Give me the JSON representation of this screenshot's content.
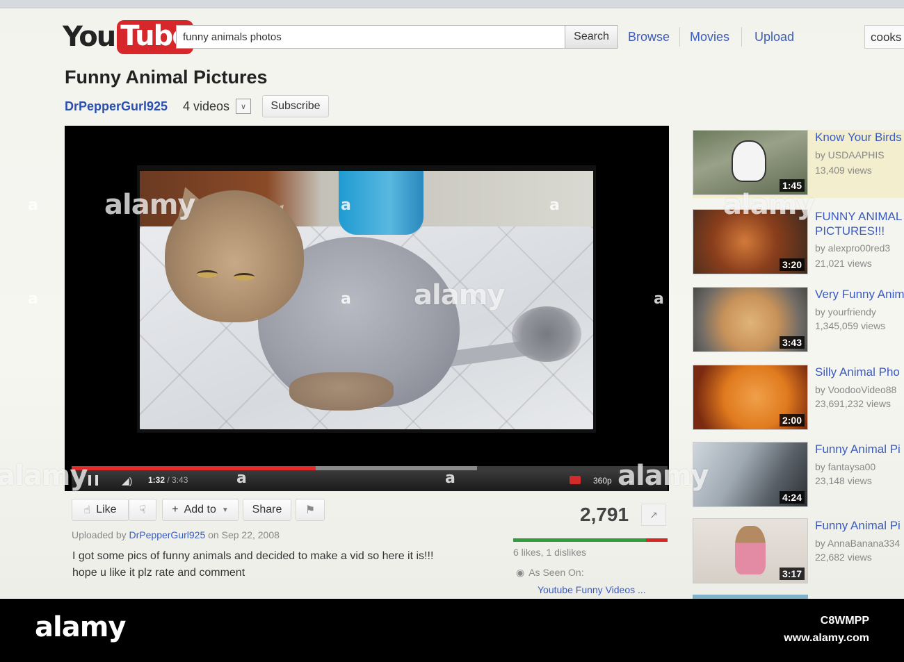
{
  "header": {
    "logo_you": "You",
    "logo_tube": "Tube",
    "search_query": "funny animals photos",
    "search_button": "Search",
    "nav": [
      "Browse",
      "Movies",
      "Upload"
    ],
    "user": "cooks"
  },
  "video": {
    "title": "Funny Animal Pictures",
    "channel": "DrPepperGurl925",
    "video_count": "4 videos",
    "subscribe": "Subscribe",
    "player": {
      "current_time": "1:32",
      "total_time": "/ 3:43",
      "quality": "360p",
      "played_fraction": 0.41,
      "buffered_fraction": 0.27
    },
    "actions": {
      "like": "Like",
      "add_to": "Add to",
      "share": "Share"
    },
    "views": "2,791",
    "likes_text": "6 likes, 1 dislikes",
    "like_ratio": 0.86,
    "uploaded_prefix": "Uploaded by",
    "uploaded_user": "DrPepperGurl925",
    "uploaded_date": "on Sep 22, 2008",
    "description_line1": "I got some pics of funny animals and decided to make a vid so here it is!!!",
    "description_line2": "hope u like it plz rate and comment",
    "as_seen_on": "As Seen On:",
    "as_seen_link": "Youtube Funny Videos ..."
  },
  "related": [
    {
      "title": "Know Your Birds",
      "by": "by USDAAPHIS",
      "views": "13,409 views",
      "duration": "1:45"
    },
    {
      "title": "FUNNY ANIMAL PICTURES!!!",
      "by": "by alexpro00red3",
      "views": "21,021 views",
      "duration": "3:20"
    },
    {
      "title": "Very Funny Anim",
      "by": "by yourfriendy",
      "views": "1,345,059 views",
      "duration": "3:43"
    },
    {
      "title": "Silly Animal Pho",
      "by": "by VoodooVideo88",
      "views": "23,691,232 views",
      "duration": "2:00"
    },
    {
      "title": "Funny Animal Pi",
      "by": "by fantaysa00",
      "views": "23,148 views",
      "duration": "4:24"
    },
    {
      "title": "Funny Animal Pi",
      "by": "by AnnaBanana334",
      "views": "22,682 views",
      "duration": "3:17"
    }
  ],
  "watermark": {
    "text": "alamy",
    "image_id": "C8WMPP",
    "site": "www.alamy.com"
  },
  "colors": {
    "link": "#3b5bbd",
    "progress_played": "#e32b2b",
    "like_green": "#2f9d3b",
    "dislike_red": "#d62727"
  }
}
